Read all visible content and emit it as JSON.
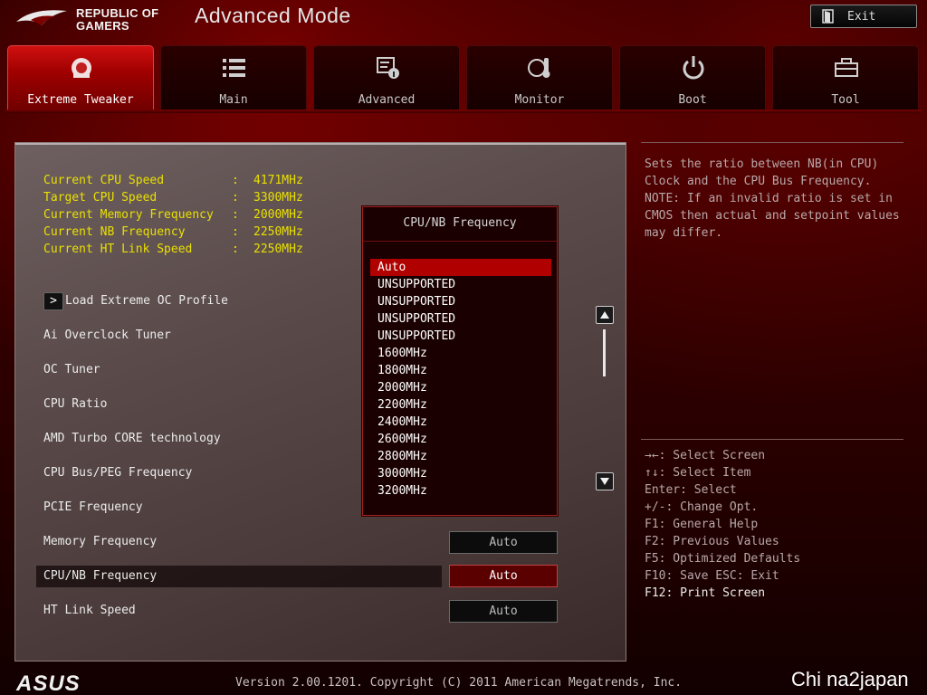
{
  "header": {
    "brand_line1": "REPUBLIC OF",
    "brand_line2": "GAMERS",
    "mode_title": "Advanced Mode",
    "exit_label": "Exit"
  },
  "tabs": [
    {
      "label": "Extreme Tweaker",
      "icon": "tweaker-icon",
      "active": true
    },
    {
      "label": "Main",
      "icon": "list-icon",
      "active": false
    },
    {
      "label": "Advanced",
      "icon": "advanced-icon",
      "active": false
    },
    {
      "label": "Monitor",
      "icon": "thermometer-icon",
      "active": false
    },
    {
      "label": "Boot",
      "icon": "power-icon",
      "active": false
    },
    {
      "label": "Tool",
      "icon": "toolbox-icon",
      "active": false
    }
  ],
  "info": [
    {
      "label": "Current CPU Speed",
      "colon": ":",
      "value": "4171MHz"
    },
    {
      "label": "Target CPU Speed",
      "colon": ":",
      "value": "3300MHz"
    },
    {
      "label": "Current Memory Frequency",
      "colon": ":",
      "value": "2000MHz"
    },
    {
      "label": "Current NB Frequency",
      "colon": ":",
      "value": "2250MHz"
    },
    {
      "label": "Current HT Link Speed",
      "colon": ":",
      "value": "2250MHz"
    }
  ],
  "submenu": {
    "label": "Load Extreme OC Profile",
    "arrow": ">"
  },
  "items": [
    {
      "label": "Ai Overclock Tuner"
    },
    {
      "label": "OC Tuner"
    },
    {
      "label": "CPU Ratio"
    },
    {
      "label": "AMD Turbo CORE technology"
    },
    {
      "label": "CPU Bus/PEG Frequency"
    },
    {
      "label": "PCIE Frequency"
    },
    {
      "label": "Memory Frequency",
      "value": "Auto"
    },
    {
      "label": "CPU/NB Frequency",
      "value": "Auto"
    },
    {
      "label": "HT Link Speed",
      "value": "Auto"
    }
  ],
  "dropdown": {
    "title": "CPU/NB Frequency",
    "options": [
      "Auto",
      "UNSUPPORTED",
      "UNSUPPORTED",
      "UNSUPPORTED",
      "UNSUPPORTED",
      "1600MHz",
      "1800MHz",
      "2000MHz",
      "2200MHz",
      "2400MHz",
      "2600MHz",
      "2800MHz",
      "3000MHz",
      "3200MHz"
    ],
    "selected": "Auto"
  },
  "help": {
    "description": "Sets the ratio between NB(in CPU)\nClock and the CPU Bus Frequency.\nNOTE: If an invalid ratio is set in\nCMOS then actual and setpoint values\nmay differ.",
    "keys": [
      "→←: Select Screen",
      "↑↓: Select Item",
      "Enter: Select",
      "+/-: Change Opt.",
      "F1: General Help",
      "F2: Previous Values",
      "F5: Optimized Defaults",
      "F10: Save  ESC: Exit",
      "F12: Print Screen"
    ]
  },
  "footer": {
    "logo": "ASUS",
    "version": "Version 2.00.1201. Copyright (C) 2011 American Megatrends, Inc.",
    "watermark": "Chi na2japan"
  },
  "colors": {
    "accent_red": "#b00000",
    "info_yellow": "#e8e000"
  }
}
